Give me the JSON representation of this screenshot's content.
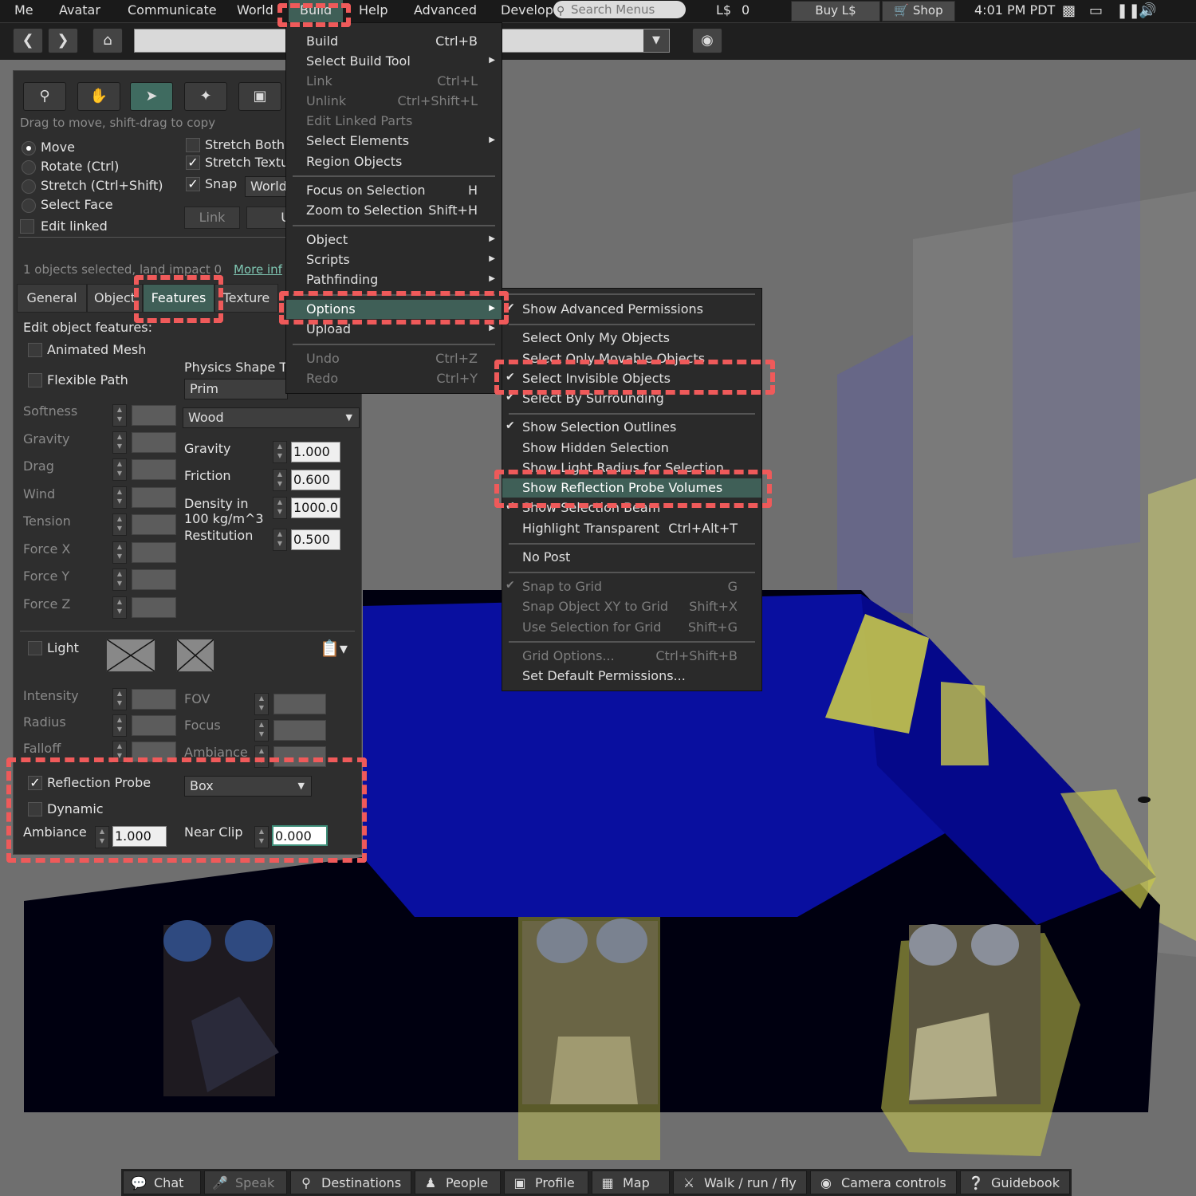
{
  "menubar": {
    "items": [
      "Me",
      "Avatar",
      "Communicate",
      "World",
      "Build",
      "Help",
      "Advanced",
      "Develop"
    ],
    "search_placeholder": "Search Menus",
    "balance_label": "L$",
    "balance_value": "0",
    "buy_label": "Buy L$",
    "shop_label": "Shop",
    "clock": "4:01 PM PDT"
  },
  "floater": {
    "hint": "Drag to move, shift-drag to copy",
    "modes": [
      "Move",
      "Rotate (Ctrl)",
      "Stretch (Ctrl+Shift)",
      "Select Face"
    ],
    "edit_linked": "Edit linked",
    "stretch_both": "Stretch Both",
    "stretch_textures": "Stretch Textu",
    "snap": "Snap",
    "snap_mode": "World",
    "link_btn": "Link",
    "unlink_btn": "U",
    "selection_info": "1 objects selected, land impact 0",
    "more_info": "More inf",
    "tabs": [
      "General",
      "Object",
      "Features",
      "Texture"
    ],
    "edit_features": "Edit object features:",
    "animated_mesh": "Animated Mesh",
    "flexible_path": "Flexible Path",
    "physics_shape_label": "Physics Shape Ty",
    "physics_shape_value": "Prim",
    "material_value": "Wood",
    "flex_params": [
      "Softness",
      "Gravity",
      "Drag",
      "Wind",
      "Tension",
      "Force X",
      "Force Y",
      "Force Z"
    ],
    "physics": {
      "gravity_label": "Gravity",
      "gravity": "1.000",
      "friction_label": "Friction",
      "friction": "0.600",
      "density_label_1": "Density in",
      "density_label_2": "100 kg/m^3",
      "density": "1000.0",
      "restitution_label": "Restitution",
      "restitution": "0.500"
    },
    "light": "Light",
    "light_params": [
      "Intensity",
      "Radius",
      "Falloff"
    ],
    "light_params_right": [
      "FOV",
      "Focus",
      "Ambiance"
    ],
    "reflection_probe": "Reflection Probe",
    "probe_shape": "Box",
    "dynamic": "Dynamic",
    "ambiance_label": "Ambiance",
    "ambiance": "1.000",
    "near_clip_label": "Near Clip",
    "near_clip": "0.000"
  },
  "build_menu": [
    {
      "label": "Build",
      "shortcut": "Ctrl+B"
    },
    {
      "label": "Select Build Tool",
      "submenu": true
    },
    {
      "label": "Link",
      "shortcut": "Ctrl+L",
      "disabled": true
    },
    {
      "label": "Unlink",
      "shortcut": "Ctrl+Shift+L",
      "disabled": true
    },
    {
      "label": "Edit Linked Parts",
      "disabled": true
    },
    {
      "label": "Select Elements",
      "submenu": true
    },
    {
      "label": "Region Objects"
    },
    {
      "label": "Focus on Selection",
      "shortcut": "H"
    },
    {
      "label": "Zoom to Selection",
      "shortcut": "Shift+H"
    },
    {
      "label": "Object",
      "submenu": true
    },
    {
      "label": "Scripts",
      "submenu": true
    },
    {
      "label": "Pathfinding",
      "submenu": true
    },
    {
      "label": "Options",
      "submenu": true,
      "highlighted": true
    },
    {
      "label": "Upload",
      "submenu": true
    },
    {
      "label": "Undo",
      "shortcut": "Ctrl+Z",
      "disabled": true
    },
    {
      "label": "Redo",
      "shortcut": "Ctrl+Y",
      "disabled": true
    }
  ],
  "options_menu": [
    {
      "label": "Show Advanced Permissions",
      "checked": true
    },
    {
      "label": "Select Only My Objects"
    },
    {
      "label": "Select Only Movable Objects"
    },
    {
      "label": "Select Invisible Objects",
      "checked": true
    },
    {
      "label": "Select By Surrounding",
      "checked": true
    },
    {
      "label": "Show Selection Outlines",
      "checked": true
    },
    {
      "label": "Show Hidden Selection"
    },
    {
      "label": "Show Light Radius for Selection"
    },
    {
      "label": "Show Reflection Probe Volumes",
      "highlighted": true
    },
    {
      "label": "Show Selection Beam",
      "checked": true
    },
    {
      "label": "Highlight Transparent",
      "shortcut": "Ctrl+Alt+T"
    },
    {
      "label": "No Post"
    },
    {
      "label": "Snap to Grid",
      "shortcut": "G",
      "checked": true,
      "disabled": true
    },
    {
      "label": "Snap Object XY to Grid",
      "shortcut": "Shift+X",
      "disabled": true
    },
    {
      "label": "Use Selection for Grid",
      "shortcut": "Shift+G",
      "disabled": true
    },
    {
      "label": "Grid Options...",
      "shortcut": "Ctrl+Shift+B",
      "disabled": true
    },
    {
      "label": "Set Default Permissions..."
    }
  ],
  "bottombar": [
    {
      "label": "Chat",
      "icon": "chat-icon"
    },
    {
      "label": "Speak",
      "icon": "microphone-icon",
      "disabled": true
    },
    {
      "label": "Destinations",
      "icon": "pin-icon"
    },
    {
      "label": "People",
      "icon": "people-icon"
    },
    {
      "label": "Profile",
      "icon": "profile-icon"
    },
    {
      "label": "Map",
      "icon": "map-icon"
    },
    {
      "label": "Walk / run / fly",
      "icon": "walk-icon"
    },
    {
      "label": "Camera controls",
      "icon": "eye-icon"
    },
    {
      "label": "Guidebook",
      "icon": "guidebook-icon"
    }
  ],
  "colors": {
    "accent": "#3f5f57",
    "annotation": "#ef5a5a",
    "probe_blue": "#0a12b8",
    "probe_yellow": "#d6d64a"
  }
}
